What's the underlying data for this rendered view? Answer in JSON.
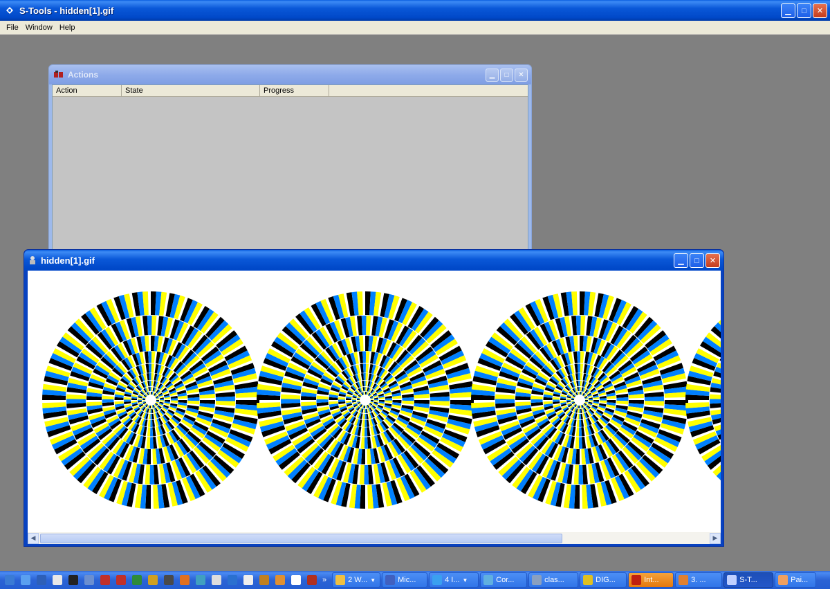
{
  "app": {
    "title": "S-Tools - hidden[1].gif"
  },
  "menu": [
    "File",
    "Window",
    "Help"
  ],
  "actions_window": {
    "title": "Actions",
    "columns": [
      "Action",
      "State",
      "Progress"
    ]
  },
  "image_window": {
    "title": "hidden[1].gif"
  },
  "colors": {
    "yellow": "#ffff00",
    "blue": "#0080ff",
    "black": "#000000"
  },
  "quicklaunch": [
    "show-desktop-icon",
    "explorer-icon",
    "app-icon",
    "notepad-icon",
    "cmd-icon",
    "calculator-icon",
    "acrobat-icon",
    "app-icon",
    "paint-icon",
    "digital-icon",
    "tools-icon",
    "paintbrush-icon",
    "network-icon",
    "window-icon",
    "browser-icon",
    "window-icon",
    "app-icon",
    "tools-icon",
    "window-icon",
    "app-icon"
  ],
  "tasks": [
    {
      "label": "2 W...",
      "icon": "folder-icon",
      "dropdown": true
    },
    {
      "label": "Mic...",
      "icon": "app-icon",
      "dropdown": false
    },
    {
      "label": "4 I...",
      "icon": "ie-icon",
      "dropdown": true
    },
    {
      "label": "Cor...",
      "icon": "network-icon",
      "dropdown": false
    },
    {
      "label": "clas...",
      "icon": "explorer-icon",
      "dropdown": false
    },
    {
      "label": "DIG...",
      "icon": "digital-icon",
      "dropdown": false
    },
    {
      "label": "Int...",
      "icon": "flash-icon",
      "dropdown": false,
      "highlight": true
    },
    {
      "label": "3. ...",
      "icon": "tools-icon",
      "dropdown": false
    },
    {
      "label": "S-T...",
      "icon": "stools-icon",
      "dropdown": false,
      "active": true
    },
    {
      "label": "Pai...",
      "icon": "paint-icon",
      "dropdown": false
    }
  ]
}
